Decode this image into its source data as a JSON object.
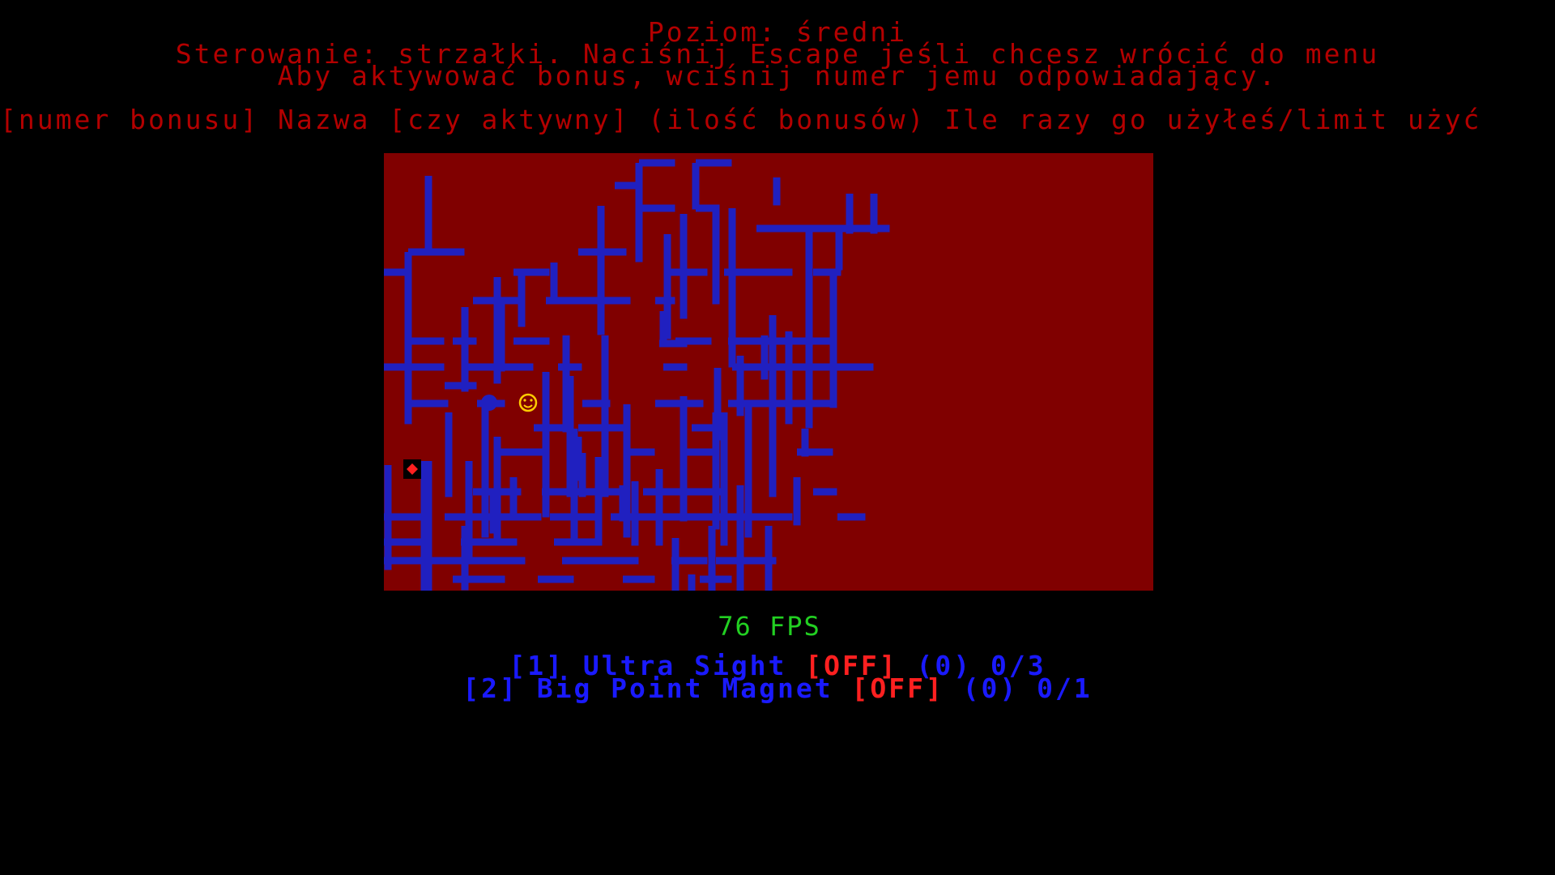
{
  "header": {
    "level": "Poziom: średni",
    "controls": "Sterowanie: strzałki. Naciśnij Escape jeśli chcesz wrócić do menu",
    "bonus_hint": "Aby aktywować bonus, wciśnij numer jemu odpowiadający.",
    "legend": "[numer bonusu] Nazwa [czy aktywny] (ilość bonusów) Ile razy go użyłeś/limit użyć"
  },
  "fps": "76 FPS",
  "bonuses": [
    {
      "key": "[1]",
      "name": "Ultra Sight",
      "state": "[OFF]",
      "count": "(0)",
      "usage": "0/3"
    },
    {
      "key": "[2]",
      "name": "Big Point Magnet",
      "state": "[OFF]",
      "count": "(0)",
      "usage": "0/1"
    }
  ],
  "colors": {
    "background": "#000000",
    "board": "#800000",
    "wall": "#2020c0",
    "text_red": "#b30000",
    "fps_green": "#22d022",
    "bonus_blue": "#1a1aff",
    "bonus_off": "#ff2020",
    "player": "#ffcc00",
    "enemy": "#2020c0",
    "item": "#ff2020"
  },
  "sprites": {
    "player": "smiley-face",
    "enemy": "blue-ball",
    "item": "red-diamond"
  }
}
